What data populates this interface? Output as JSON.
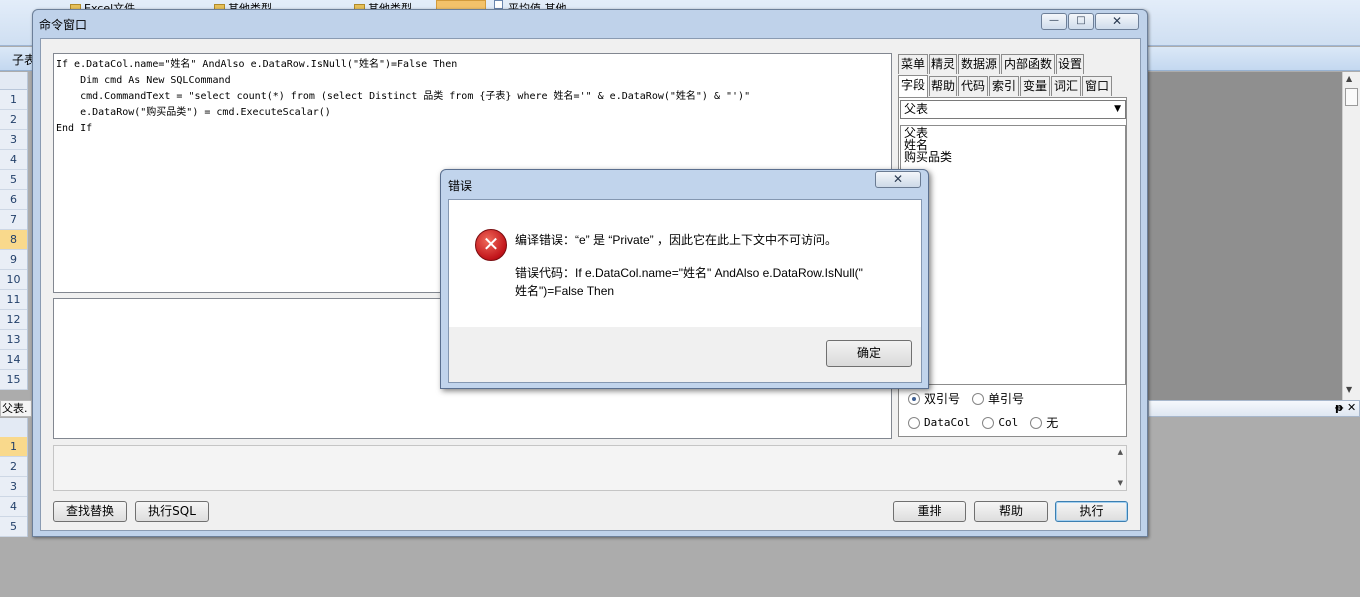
{
  "background": {
    "ribbon": {
      "item1": "Excel文件",
      "item2": "其他类型",
      "item3": "其他类型",
      "item4": "平均值 其他"
    },
    "bluebar_label": "子表",
    "row_numbers_top": [
      "1",
      "2",
      "3",
      "4",
      "5",
      "6",
      "7",
      "8",
      "9",
      "10",
      "11",
      "12",
      "13",
      "14",
      "15"
    ],
    "highlighted_top_row": "8",
    "row_numbers_bottom": [
      "1",
      "2",
      "3",
      "4",
      "5"
    ],
    "highlighted_bottom_row": "1",
    "subpanel_label": "父表.",
    "dock_pin": "📌",
    "dock_close": "✕"
  },
  "command_window": {
    "title": "命令窗口",
    "min_label": "—",
    "max_label": "□",
    "close_label": "✕",
    "code_lines": [
      "If e.DataCol.name=\"姓名\" AndAlso e.DataRow.IsNull(\"姓名\")=False Then",
      "    Dim cmd As New SQLCommand",
      "    cmd.CommandText = \"select count(*) from (select Distinct 品类 from {子表} where 姓名='\" & e.DataRow(\"姓名\") & \"')\"",
      "    e.DataRow(\"购买品类\") = cmd.ExecuteScalar()",
      "End If"
    ],
    "buttons": {
      "find_replace": "查找替换",
      "exec_sql": "执行SQL",
      "reset": "重排",
      "help": "帮助",
      "execute": "执行"
    },
    "tabs_row1": [
      "菜单",
      "精灵",
      "数据源",
      "内部函数",
      "设置"
    ],
    "tabs_row2": [
      "字段",
      "帮助",
      "代码",
      "索引",
      "变量",
      "词汇",
      "窗口"
    ],
    "active_tab": "字段",
    "table_select": "父表",
    "fields": [
      "父表",
      "姓名",
      "购买品类"
    ],
    "quote_options": {
      "double": "双引号",
      "single": "单引号"
    },
    "col_options": {
      "datacol": "DataCol",
      "col": "Col",
      "none": "无"
    }
  },
  "error_dialog": {
    "title": "错误",
    "close_label": "✕",
    "message": "编译错误：“e” 是 “Private” ，因此它在此上下文中不可访问。",
    "code_text": "错误代码：If e.DataCol.name=\"姓名\" AndAlso e.DataRow.IsNull(\"\n姓名\")=False Then",
    "ok_label": "确定",
    "icon": "error-x-icon"
  }
}
